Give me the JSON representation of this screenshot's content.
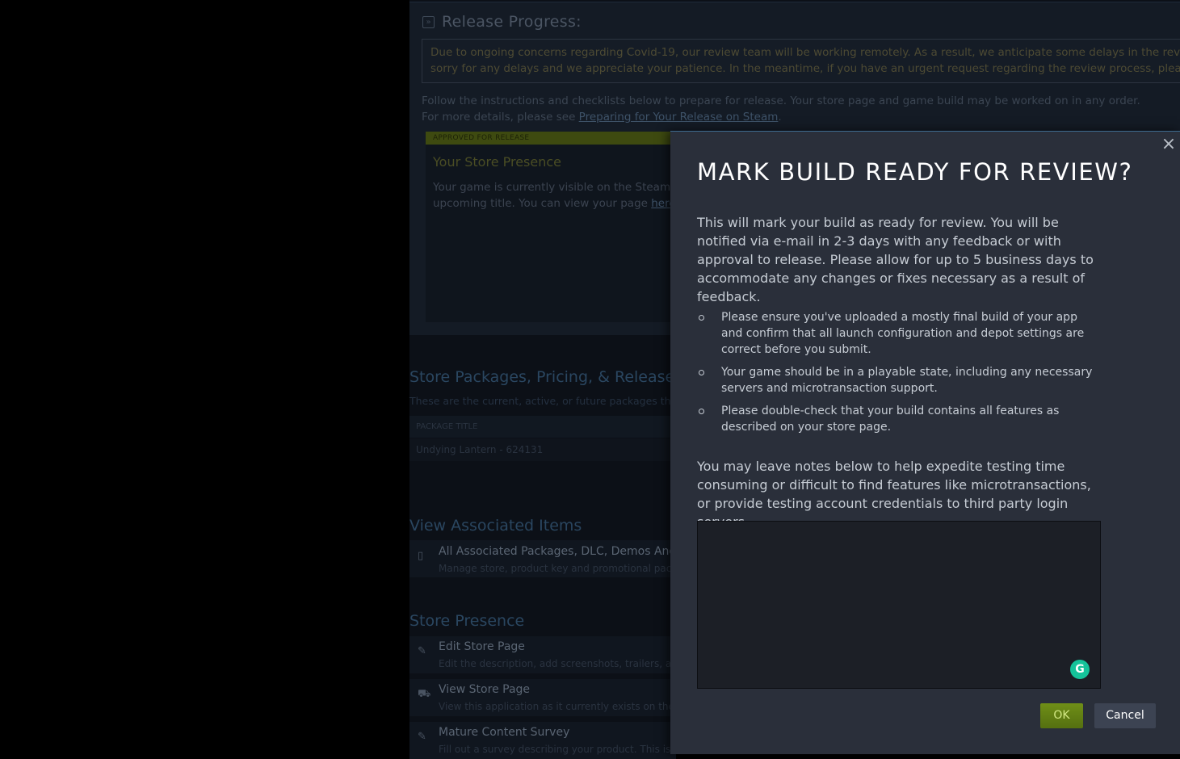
{
  "background_page": {
    "release_progress": {
      "title": "Release Progress:",
      "notice_line1": "Due to ongoing concerns regarding Covid-19, our review team will be working remotely. As a result, we anticipate some delays in the review pr",
      "notice_line2": "sorry for any delays and we appreciate your patience. In the meantime, if you have an urgent request regarding the review process, please reac",
      "instructions_line1": "Follow the instructions and checklists below to prepare for release. Your store page and game build may be worked on in any order.",
      "instructions_line2_prefix": "For more details, please see ",
      "instructions_link": "Preparing for Your Release on Steam",
      "instructions_line2_suffix": ".",
      "store_card": {
        "badge": "APPROVED FOR RELEASE",
        "title": "Your Store Presence",
        "text_line1": "Your game is currently visible on the Steam S",
        "text_line2_prefix": "upcoming title. You can view your page ",
        "text_link": "here"
      }
    },
    "packages": {
      "title": "Store Packages, Pricing, & Release",
      "subtitle": "These are the current, active, or future packages that",
      "column_header": "PACKAGE TITLE",
      "row": "Undying Lantern - 624131"
    },
    "associated": {
      "title": "View Associated Items",
      "item_title": "All Associated Packages, DLC, Demos And T",
      "item_sub": "Manage store, product key and promotional packag"
    },
    "store_presence": {
      "title": "Store Presence",
      "items": [
        {
          "title": "Edit Store Page",
          "sub": "Edit the description, add screenshots, trailers, art a",
          "icon": "edit-icon"
        },
        {
          "title": "View Store Page",
          "sub": "View this application as it currently exists on the St",
          "icon": "cart-icon"
        },
        {
          "title": "Mature Content Survey",
          "sub": "Fill out a survey describing your product. This is re",
          "icon": "edit-icon"
        }
      ]
    }
  },
  "modal": {
    "title": "MARK BUILD READY FOR REVIEW?",
    "intro": "This will mark your build as ready for review. You will be notified via e-mail in 2-3 days with any feedback or with approval to release. Please allow for up to 5 business days to accommodate any changes or fixes necessary as a result of feedback.",
    "bullets": [
      "Please ensure you've uploaded a mostly final build of your app and confirm that all launch configuration and depot settings are correct before you submit.",
      "Your game should be in a playable state, including any necessary servers and microtransaction support.",
      "Please double-check that your build contains all features as described on your store page."
    ],
    "notes_label": "You may leave notes below to help expedite testing time consuming or difficult to find features like microtransactions, or provide testing account credentials to third party login servers.",
    "notes_value": "",
    "close_glyph": "×",
    "grammarly_glyph": "G",
    "ok_label": "OK",
    "cancel_label": "Cancel"
  },
  "colors": {
    "ok_button": "#6f8f17",
    "modal_bg": "#2a2f3a",
    "grammarly": "#15c39a"
  }
}
